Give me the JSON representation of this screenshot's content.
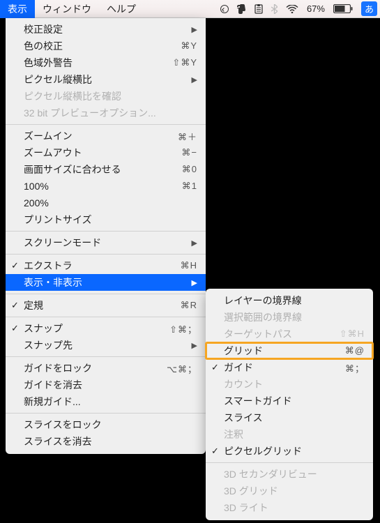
{
  "menubar": {
    "items": [
      "表示",
      "ウィンドウ",
      "ヘルプ"
    ],
    "active_index": 0,
    "status": {
      "battery_pct": "67%",
      "ime": "あ"
    }
  },
  "menu": {
    "groups": [
      [
        {
          "label": "校正設定",
          "submenu": true
        },
        {
          "label": "色の校正",
          "shortcut": "⌘Y"
        },
        {
          "label": "色域外警告",
          "shortcut": "⇧⌘Y"
        },
        {
          "label": "ピクセル縦横比",
          "submenu": true
        },
        {
          "label": "ピクセル縦横比を確認",
          "disabled": true
        },
        {
          "label": "32 bit プレビューオプション...",
          "disabled": true
        }
      ],
      [
        {
          "label": "ズームイン",
          "shortcut": "⌘＋"
        },
        {
          "label": "ズームアウト",
          "shortcut": "⌘−"
        },
        {
          "label": "画面サイズに合わせる",
          "shortcut": "⌘0"
        },
        {
          "label": "100%",
          "shortcut": "⌘1"
        },
        {
          "label": "200%"
        },
        {
          "label": "プリントサイズ"
        }
      ],
      [
        {
          "label": "スクリーンモード",
          "submenu": true
        }
      ],
      [
        {
          "label": "エクストラ",
          "shortcut": "⌘H",
          "checked": true
        },
        {
          "label": "表示・非表示",
          "submenu": true,
          "highlight": true
        }
      ],
      [
        {
          "label": "定規",
          "shortcut": "⌘R",
          "checked": true
        }
      ],
      [
        {
          "label": "スナップ",
          "shortcut": "⇧⌘；",
          "checked": true
        },
        {
          "label": "スナップ先",
          "submenu": true
        }
      ],
      [
        {
          "label": "ガイドをロック",
          "shortcut": "⌥⌘；"
        },
        {
          "label": "ガイドを消去"
        },
        {
          "label": "新規ガイド..."
        }
      ],
      [
        {
          "label": "スライスをロック"
        },
        {
          "label": "スライスを消去"
        }
      ]
    ]
  },
  "submenu": {
    "groups": [
      [
        {
          "label": "レイヤーの境界線"
        },
        {
          "label": "選択範囲の境界線",
          "disabled": true
        },
        {
          "label": "ターゲットパス",
          "shortcut": "⇧⌘H",
          "disabled": true
        },
        {
          "label": "グリッド",
          "shortcut": "⌘@",
          "highlight_box": true
        },
        {
          "label": "ガイド",
          "shortcut": "⌘；",
          "checked": true
        },
        {
          "label": "カウント",
          "disabled": true
        },
        {
          "label": "スマートガイド"
        },
        {
          "label": "スライス"
        },
        {
          "label": "注釈",
          "disabled": true
        },
        {
          "label": "ピクセルグリッド",
          "checked": true
        }
      ],
      [
        {
          "label": "3D セカンダリビュー",
          "disabled": true
        },
        {
          "label": "3D グリッド",
          "disabled": true
        },
        {
          "label": "3D ライト",
          "disabled": true
        }
      ]
    ]
  }
}
